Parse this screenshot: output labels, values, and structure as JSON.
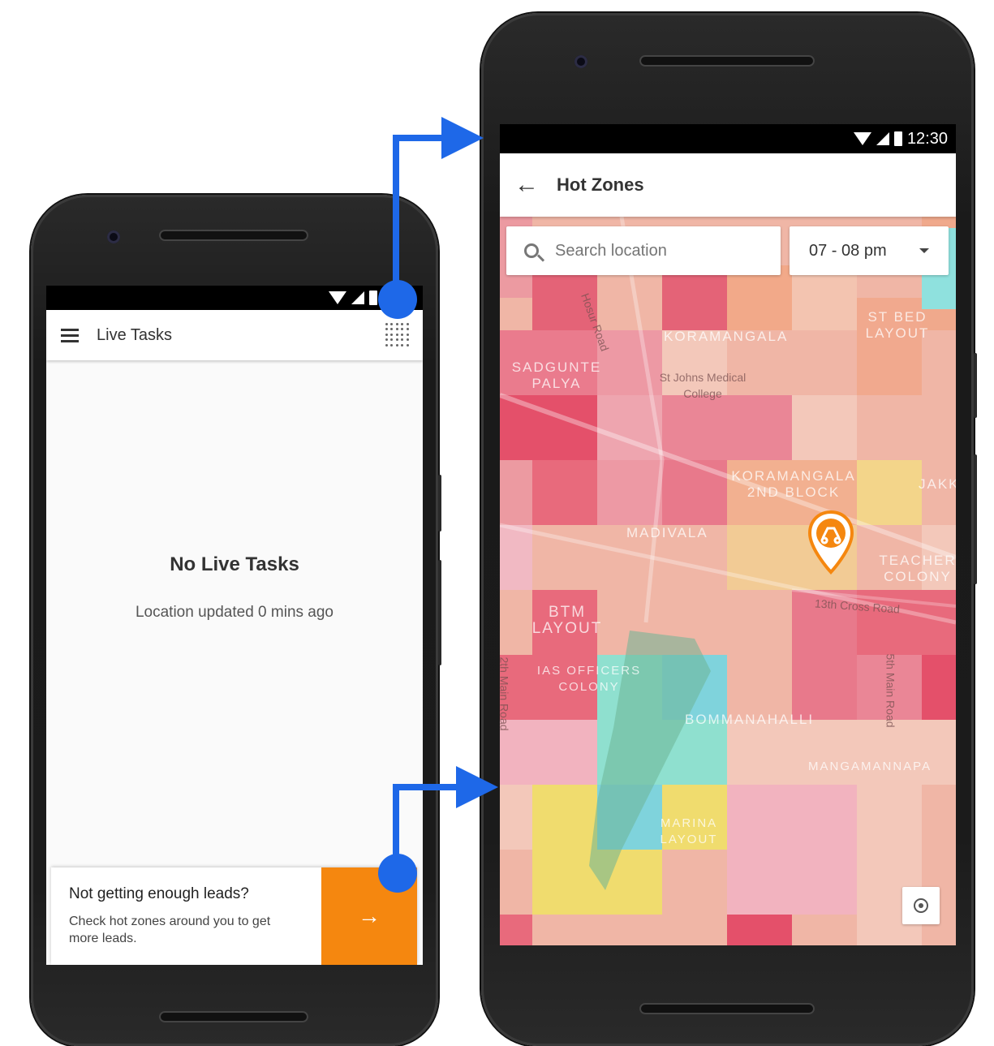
{
  "left_screen": {
    "toolbar": {
      "title": "Live Tasks",
      "menu_icon": "hamburger-icon",
      "hotzone_icon": "dot-grid-icon"
    },
    "empty_state": {
      "title": "No Live Tasks",
      "subtitle": "Location updated 0 mins ago"
    },
    "lead_card": {
      "title": "Not getting enough leads?",
      "subtitle": "Check hot zones around you to get more leads.",
      "button_icon": "arrow-right-icon",
      "button_glyph": "→"
    }
  },
  "right_screen": {
    "status_bar": {
      "time": "12:30"
    },
    "toolbar": {
      "title": "Hot Zones",
      "back_icon": "back-arrow-icon",
      "back_glyph": "←"
    },
    "search": {
      "placeholder": "Search location"
    },
    "time_filter": {
      "value": "07 - 08 pm"
    },
    "map_labels": {
      "koramangala": "KORAMANGALA",
      "st_bed": "ST BED LAYOUT",
      "sadgunte": "SADGUNTE PALYA",
      "st_johns": "St Johns Medical College",
      "koramangala_2nd": "KORAMANGALA 2ND BLOCK",
      "jakk": "JAKK",
      "madivala": "MADIVALA",
      "teacher": "TEACHER COLONY",
      "btm": "BTM LAYOUT",
      "cross_road": "13th Cross Road",
      "main_road_5": "5th Main Road",
      "main_road_2": "2th Main Road",
      "ias": "IAS OFFICERS COLONY",
      "bommanahalli": "BOMMANAHALLI",
      "mangamanna": "MANGAMANNAPA",
      "marina": "MARINA LAYOUT",
      "hosur": "Hosur Road"
    }
  },
  "colors": {
    "accent": "#f5870f",
    "connector": "#1e68e8"
  }
}
